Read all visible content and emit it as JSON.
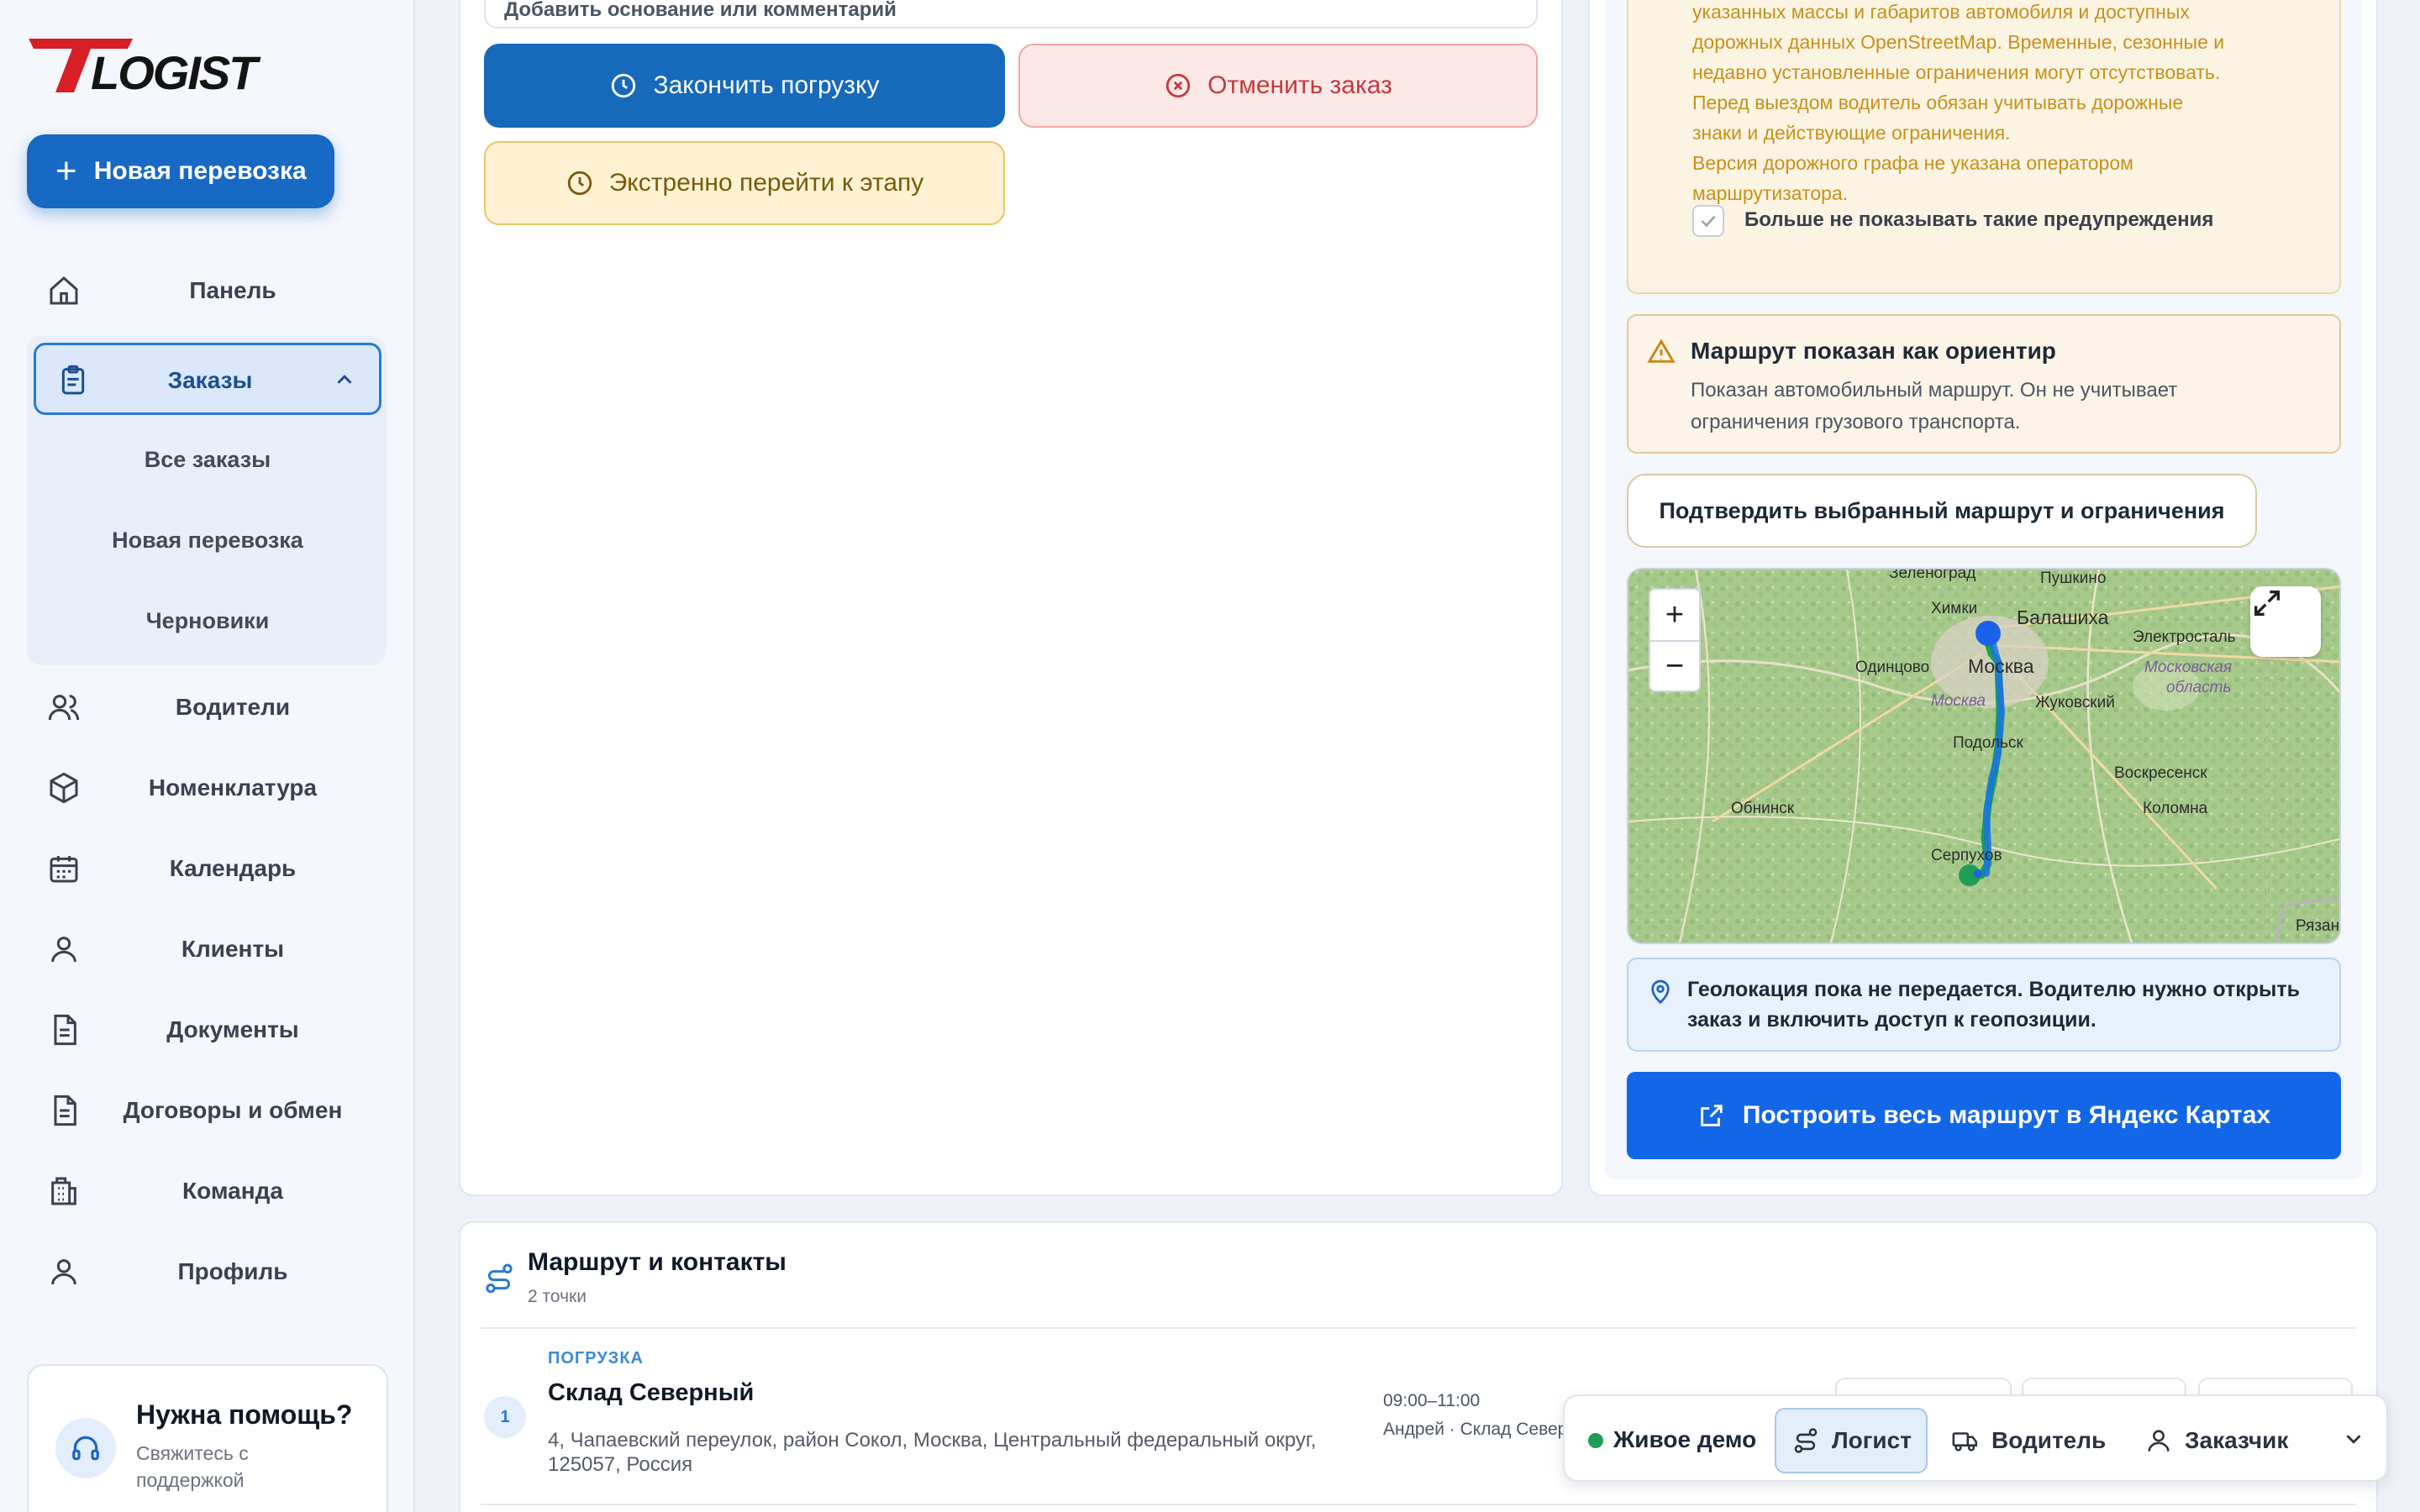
{
  "app": {
    "logo_text": "TLOGIST",
    "new_shipment_label": "Новая перевозка"
  },
  "sidebar": {
    "items": [
      {
        "label": "Панель",
        "icon": "home-icon"
      },
      {
        "label": "Заказы",
        "icon": "clipboard-icon"
      },
      {
        "label": "Водители",
        "icon": "users-icon"
      },
      {
        "label": "Номенклатура",
        "icon": "package-icon"
      },
      {
        "label": "Календарь",
        "icon": "calendar-icon"
      },
      {
        "label": "Клиенты",
        "icon": "user-icon"
      },
      {
        "label": "Документы",
        "icon": "document-icon"
      },
      {
        "label": "Договоры и обмен",
        "icon": "document-icon"
      },
      {
        "label": "Команда",
        "icon": "building-icon"
      },
      {
        "label": "Профиль",
        "icon": "user-icon"
      }
    ],
    "orders_sub": [
      "Все заказы",
      "Новая перевозка",
      "Черновики"
    ],
    "help": {
      "title": "Нужна помощь?",
      "subtitle": "Свяжитесь с поддержкой"
    }
  },
  "order_actions": {
    "comment_placeholder": "Добавить основание или комментарий",
    "finish_loading": "Закончить погрузку",
    "cancel_order": "Отменить заказ",
    "urgent_stage": "Экстренно перейти к этапу"
  },
  "route_panel": {
    "warning_text": [
      "указанных массы и габаритов автомобиля и доступных",
      "дорожных данных OpenStreetMap. Временные, сезонные и",
      "недавно установленные ограничения могут отсутствовать.",
      "Перед выездом водитель обязан учитывать дорожные",
      "знаки и действующие ограничения.",
      "Версия дорожного графа не указана оператором",
      "маршрутизатора."
    ],
    "dont_show_label": "Больше не показывать такие предупреждения",
    "dont_show_checked": true,
    "orient_title": "Маршрут показан как ориентир",
    "orient_desc": "Показан автомобильный маршрут. Он не учитывает ограничения грузового транспорта.",
    "confirm_label": "Подтвердить выбранный маршрут и ограничения",
    "map": {
      "zoom_in": "+",
      "zoom_out": "−",
      "labels": {
        "zelenograd": "Зеленоград",
        "pushkino": "Пушкино",
        "khimki": "Химки",
        "balashikha": "Балашиха",
        "elektrostal": "Электросталь",
        "odintsovo": "Одинцово",
        "moskva": "Москва",
        "moskva_region": "Москва",
        "zhukovsky": "Жуковский",
        "moscow_oblast_1": "Московская",
        "moscow_oblast_2": "область",
        "podolsk": "Подольск",
        "voskresensk": "Воскресенск",
        "obninsk": "Обнинск",
        "kolomna": "Коломна",
        "serpukhov": "Серпухов",
        "ryazan": "Рязань"
      }
    },
    "geo_text": "Геолокация пока не передается. Водителю нужно открыть заказ и включить доступ к геопозиции.",
    "yandex_label": "Построить весь маршрут в Яндекс Картах"
  },
  "route": {
    "title": "Маршрут и контакты",
    "subtitle": "2 точки",
    "stops": [
      {
        "num": "1",
        "type": "ПОГРУЗКА",
        "name": "Склад Северный",
        "address": "4, Чапаевский переулок, район Сокол, Москва, Центральный федеральный округ, 125057, Россия",
        "time": "09:00–11:00",
        "contact": "Андрей · Склад Север"
      }
    ]
  },
  "rolebar": {
    "live_demo": "Живое демо",
    "roles": [
      "Логист",
      "Водитель",
      "Заказчик"
    ],
    "active_role": "Логист"
  },
  "colors": {
    "primary": "#1669bb",
    "yandex": "#1266e8",
    "warning_text": "#c8901b",
    "cancel": "#c23b3b",
    "brand_red": "#d81f26"
  }
}
